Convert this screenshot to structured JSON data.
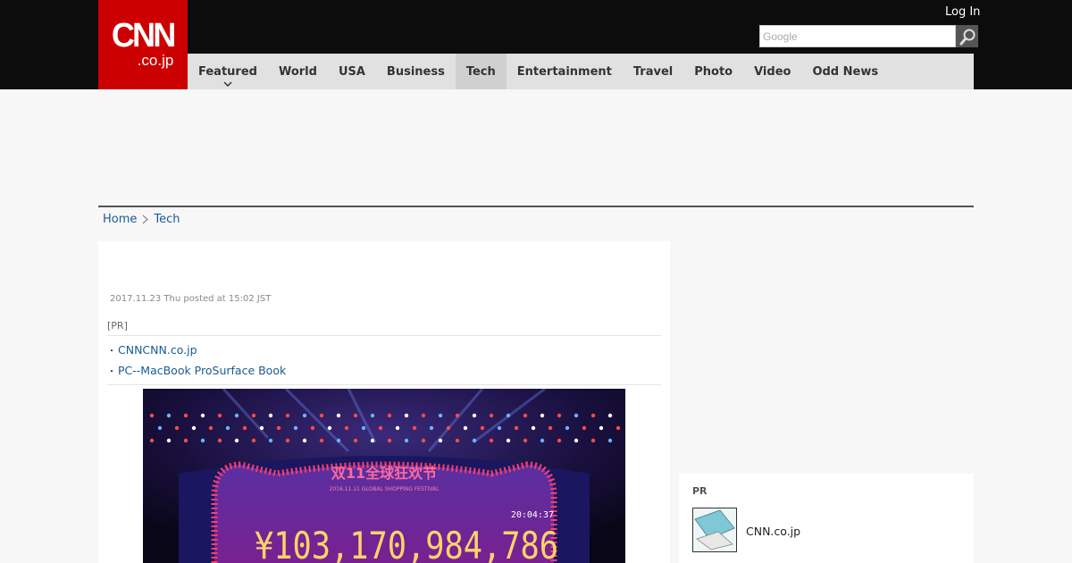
{
  "header": {
    "logo_main": "CNN",
    "logo_sub": ".co.jp",
    "login_label": "Log In",
    "search_placeholder": "Google"
  },
  "nav": {
    "items": [
      {
        "label": "Featured"
      },
      {
        "label": "World"
      },
      {
        "label": "USA"
      },
      {
        "label": "Business"
      },
      {
        "label": "Tech"
      },
      {
        "label": "Entertainment"
      },
      {
        "label": "Travel"
      },
      {
        "label": "Photo"
      },
      {
        "label": "Video"
      },
      {
        "label": "Odd News"
      }
    ],
    "active": "Tech"
  },
  "breadcrumb": {
    "home": "Home",
    "current": "Tech"
  },
  "article": {
    "posted": "2017.11.23 Thu posted at 15:02 JST",
    "pr_label": "[PR]",
    "pr_links": [
      {
        "bullet": "・",
        "text": "CNNCNN.co.jp"
      },
      {
        "bullet": "・",
        "text": "PC--MacBook ProSurface Book"
      }
    ],
    "photo": {
      "banner_title": "双11全球狂欢节",
      "banner_subtitle": "2016.11.11 GLOBAL SHOPPING FESTIVAL",
      "timer": "20:04:37",
      "amount": "¥103,170,984,786"
    }
  },
  "sidebar": {
    "pr_label": "PR",
    "item_text": "CNN.co.jp"
  },
  "colors": {
    "brand_red": "#cc0000",
    "header_bg": "#0c0c0c",
    "nav_bg": "#e1e1e1",
    "link": "#1a5a96"
  }
}
